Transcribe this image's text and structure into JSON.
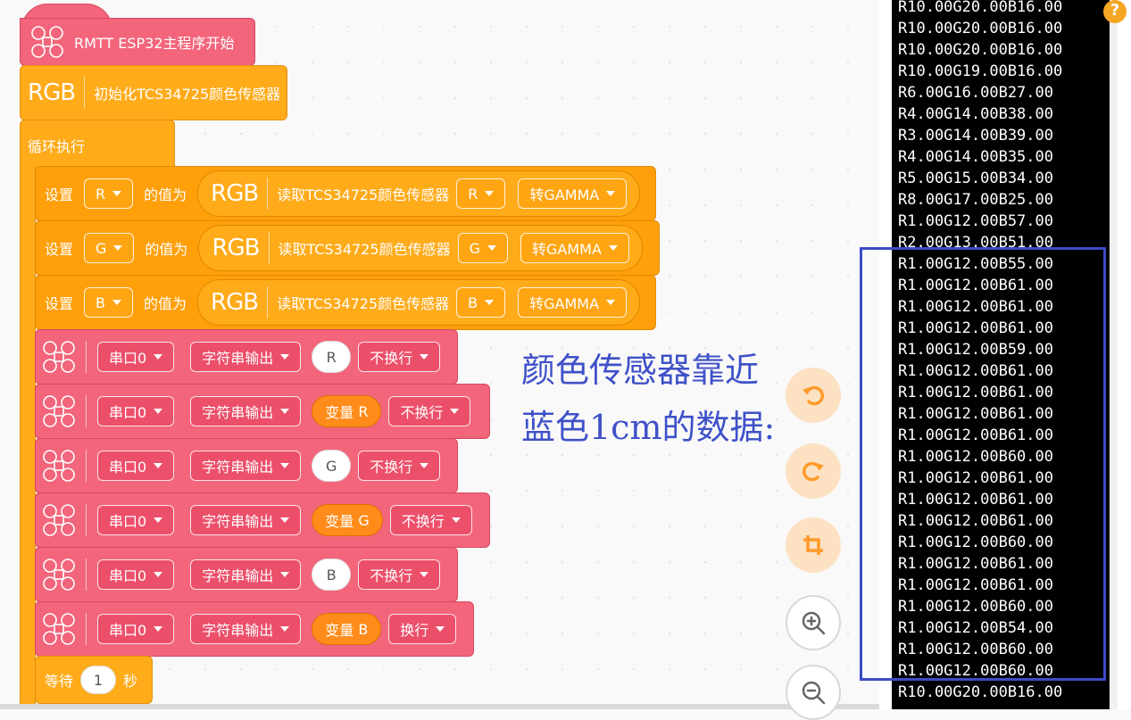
{
  "blocks": {
    "hat": "RMTT ESP32主程序开始",
    "rgb_logo": "RGB",
    "init": "初始化TCS34725颜色传感器",
    "loop": "循环执行",
    "set_label": "设置",
    "assign_label": "的值为",
    "read_label": "读取TCS34725颜色传感器",
    "gamma": "转GAMMA",
    "sets": [
      {
        "var": "R",
        "channel": "R"
      },
      {
        "var": "G",
        "channel": "G"
      },
      {
        "var": "B",
        "channel": "B"
      }
    ],
    "serial_port": "串口0",
    "serial_mode": "字符串输出",
    "var_prefix": "变量",
    "prints": [
      {
        "value": "R",
        "newline": "不换行"
      },
      {
        "value": "R",
        "newline": "不换行"
      },
      {
        "value": "G",
        "newline": "不换行"
      },
      {
        "value": "G",
        "newline": "不换行"
      },
      {
        "value": "B",
        "newline": "不换行"
      },
      {
        "value": "B",
        "newline": "换行"
      }
    ],
    "wait_label": "等待",
    "wait_value": "1",
    "wait_unit": "秒"
  },
  "annotation": {
    "line1": "颜色传感器靠近",
    "line2": "蓝色1cm的数据:"
  },
  "controls": {
    "undo_icon": "undo-icon",
    "redo_icon": "redo-icon",
    "crop_icon": "crop-icon",
    "zoom_in_icon": "zoom-in-icon",
    "zoom_out_icon": "zoom-out-icon"
  },
  "help": "?",
  "serial_output": [
    "R10.00G20.00B16.00",
    "R10.00G20.00B16.00",
    "R10.00G20.00B16.00",
    "R10.00G19.00B16.00",
    "R6.00G16.00B27.00",
    "R4.00G14.00B38.00",
    "R3.00G14.00B39.00",
    "R4.00G14.00B35.00",
    "R5.00G15.00B34.00",
    "R8.00G17.00B25.00",
    "R1.00G12.00B57.00",
    "R2.00G13.00B51.00",
    "R1.00G12.00B55.00",
    "R1.00G12.00B61.00",
    "R1.00G12.00B61.00",
    "R1.00G12.00B61.00",
    "R1.00G12.00B59.00",
    "R1.00G12.00B61.00",
    "R1.00G12.00B61.00",
    "R1.00G12.00B61.00",
    "R1.00G12.00B61.00",
    "R1.00G12.00B60.00",
    "R1.00G12.00B61.00",
    "R1.00G12.00B61.00",
    "R1.00G12.00B61.00",
    "R1.00G12.00B60.00",
    "R1.00G12.00B61.00",
    "R1.00G12.00B61.00",
    "R1.00G12.00B60.00",
    "R1.00G12.00B54.00",
    "R1.00G12.00B60.00",
    "R1.00G12.00B60.00",
    "R10.00G20.00B16.00"
  ],
  "colors": {
    "pink": "#f2657b",
    "orange": "#ffab1a",
    "annotation_blue": "#3f51c8"
  }
}
